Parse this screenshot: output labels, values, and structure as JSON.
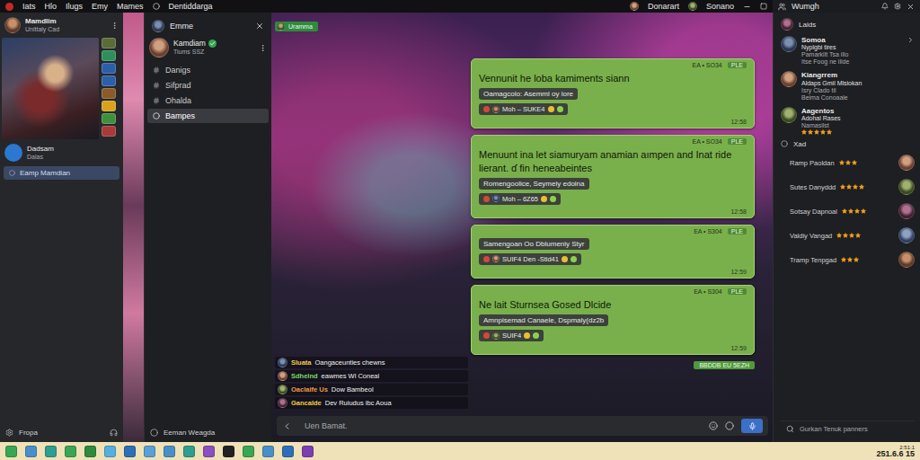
{
  "topbar": {
    "items": [
      "Iats",
      "Hlo",
      "Ilugs",
      "Emy",
      "Mames"
    ],
    "server": "Dentiddarga",
    "users": [
      "Donarart",
      "Sonano"
    ],
    "panel_title": "Wumgh"
  },
  "sidebar": {
    "user": {
      "name": "Mamdlim",
      "status": "Unittaly Cad"
    },
    "servers": [
      {
        "color": "#5b6b3a"
      },
      {
        "color": "#2f8f5a"
      },
      {
        "color": "#2d5fa8"
      },
      {
        "color": "#2d5fa8"
      },
      {
        "color": "#8a5a2a"
      },
      {
        "color": "#d8a21c"
      },
      {
        "color": "#3f8f3f"
      },
      {
        "color": "#a83a3a"
      }
    ],
    "entry": {
      "name": "Dadsam",
      "sub": "Dalas"
    },
    "items": [
      {
        "label": "Eamp Mamdian",
        "selected": true
      }
    ],
    "footer": "Fropa"
  },
  "channels": {
    "title": "Emme",
    "user": {
      "name": "Kamdiam",
      "sub": "Tiums SSZ",
      "verified": true
    },
    "items": [
      {
        "label": "Danigs",
        "selected": false
      },
      {
        "label": "Sifprad",
        "selected": false
      },
      {
        "label": "Ohalda",
        "selected": false
      },
      {
        "label": "Bampes",
        "selected": true
      }
    ],
    "footer": "Eeman Weagda"
  },
  "stream": {
    "badge": "Uramma",
    "messages": [
      {
        "meta": "EA • SO34",
        "tag": "PLE",
        "text": "Vennunit he loba kamiments siann",
        "chip": "Oamagcolo: Asemml oy lore",
        "reactions": "Moh – SUKE4",
        "time": "12:58"
      },
      {
        "meta": "EA • SO34",
        "tag": "PLE",
        "text": "Menuunt ina let siamuryam anamian aımpen and Inat ride lierant. ɗ fin heneabeintes",
        "chip": "Romengoolice, Seymeiy edoina",
        "reactions": "Moh – 6Z65",
        "time": "12:58"
      },
      {
        "meta": "EA • S304",
        "tag": "PLE",
        "chip": "Samengoan Oo Dblumeniy Styr",
        "reactions": "SUIF4 Den -Stid41",
        "time": "12:59"
      },
      {
        "meta": "EA • S304",
        "tag": "PLE",
        "text": "Ne lait Sturnsea Gosed Dlcide",
        "chip": "Amnpisemad Canaele, Dspmaly(dz2b",
        "reactions": "SUIF4",
        "time": "12:59"
      }
    ],
    "tag": "BBDDB EU 5EZH",
    "chat": [
      {
        "name": "Sluata",
        "text": "Oangaceunties chewns",
        "color": "#f2c94c"
      },
      {
        "name": "Sdhelnd",
        "text": "eawmes Wl Coneal",
        "color": "#7bd96b"
      },
      {
        "name": "Oaclaife Us",
        "text": "Dow Bambeol",
        "color": "#f2994a"
      },
      {
        "name": "Gancalde",
        "text": "Dev Ruiudus ibc Aoua",
        "color": "#f2c94c"
      }
    ],
    "input": {
      "placeholder": "Uen Bamat."
    }
  },
  "people": {
    "title": "Laids",
    "groups": [
      {
        "name": "Somoa",
        "lines": [
          "Nyplgbi tires",
          "Pamarkllt Tsa ilio",
          "Itse Foog ne ilide"
        ],
        "stars": 0
      },
      {
        "name": "Kiangrrem",
        "lines": [
          "Aldaps Gmil Mlsiokan",
          "Isry Clado til",
          "Beima Conoaale"
        ],
        "stars": 0
      },
      {
        "name": "Aagentos",
        "lines": [
          "Adohal Rases",
          "Namasilst"
        ],
        "stars": 5
      }
    ],
    "section": "Xad",
    "rows": [
      {
        "name": "Ramp Paoldan",
        "stars": 3
      },
      {
        "name": "Sutes Danyddd",
        "stars": 4
      },
      {
        "name": "Sotsay Dapnoal",
        "stars": 4
      },
      {
        "name": "Valdiy Vangad",
        "stars": 4
      },
      {
        "name": "Tramp Tenpgad",
        "stars": 3
      }
    ],
    "search": {
      "placeholder": "Gurkan Tenuk panners"
    }
  },
  "taskbar": {
    "apps": [
      {
        "color": "#3aa655"
      },
      {
        "color": "#4a90c8"
      },
      {
        "color": "#2f9e8f"
      },
      {
        "color": "#3aa655"
      },
      {
        "color": "#2e8b3e"
      },
      {
        "color": "#55b0e0"
      },
      {
        "color": "#2f6fb8"
      },
      {
        "color": "#5aa0d8"
      },
      {
        "color": "#4a90c8"
      },
      {
        "color": "#2f9e8f"
      },
      {
        "color": "#8a4fc0"
      },
      {
        "color": "#222222"
      },
      {
        "color": "#3aa655"
      },
      {
        "color": "#4a90c8"
      },
      {
        "color": "#2f6fb8"
      },
      {
        "color": "#7a3fb0"
      }
    ],
    "clock": "2:51:1",
    "date": "251.6.6 15"
  }
}
